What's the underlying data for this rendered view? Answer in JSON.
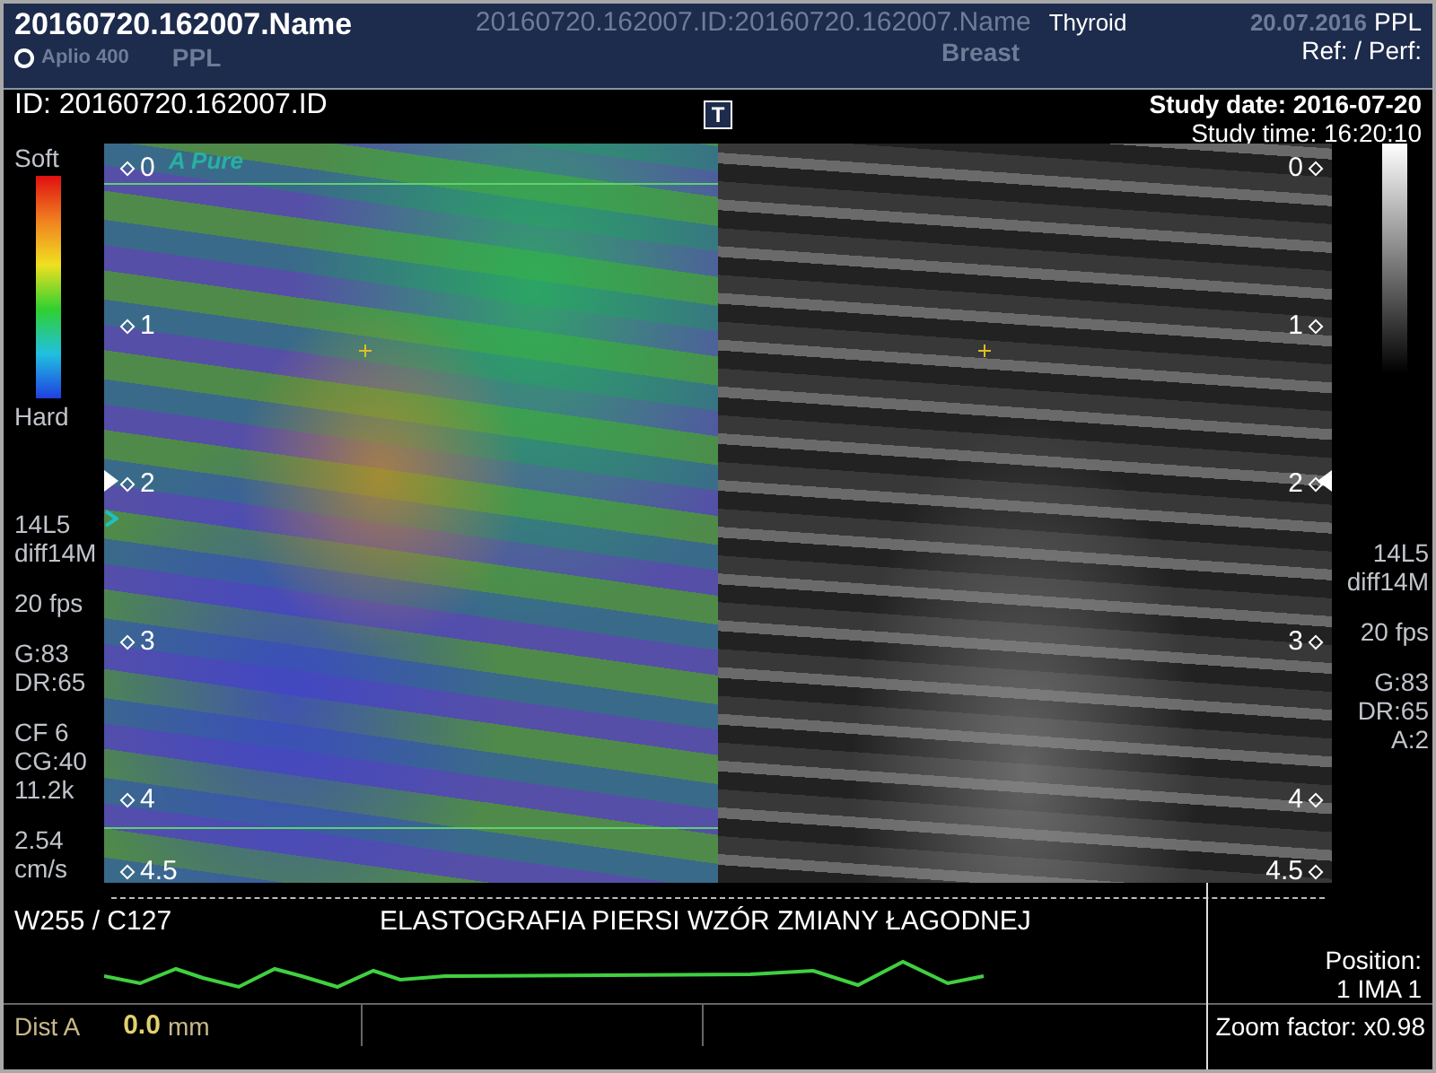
{
  "header": {
    "patient_name": "20160720.162007.Name",
    "banner_text": "20160720.162007.ID:20160720.162007.Name",
    "exam": "Thyroid",
    "preset": "Breast",
    "scanner": "Aplio 400",
    "operator": "PPL",
    "banner_date": "20.07.2016",
    "operator_right": "PPL",
    "ref_perf": "Ref: / Perf:"
  },
  "patient_id": "ID: 20160720.162007.ID",
  "study_date": "Study date: 2016-07-20",
  "study_time": "Study time: 16:20:10",
  "t_badge": "T",
  "color_scale": {
    "top": "Soft",
    "bottom": "Hard"
  },
  "left_params": [
    [
      "14L5",
      "diff14M"
    ],
    [
      "20 fps"
    ],
    [
      "G:83",
      "DR:65"
    ],
    [
      "CF 6",
      "CG:40",
      "11.2k"
    ],
    [
      "2.54",
      "cm/s"
    ]
  ],
  "right_params": [
    [
      "14L5",
      "diff14M"
    ],
    [
      "20 fps"
    ],
    [
      "G:83",
      "DR:65",
      "A:2"
    ]
  ],
  "panels": [
    {
      "kind": "elastography",
      "badge": "A Pure",
      "depth_labels": [
        "0",
        "1",
        "2",
        "3",
        "4",
        "4.5"
      ]
    },
    {
      "kind": "bmode",
      "depth_labels": [
        "0",
        "1",
        "2",
        "3",
        "4",
        "4.5"
      ]
    }
  ],
  "window_level": "W255 / C127",
  "annotation": "ELASTOGRAFIA PIERSI WZÓR ZMIANY ŁAGODNEJ",
  "position": {
    "label": "Position:",
    "value": "1 IMA 1"
  },
  "measurement": {
    "label": "Dist A",
    "value": "0.0",
    "unit": "mm"
  },
  "zoom": "Zoom factor: x0.98"
}
